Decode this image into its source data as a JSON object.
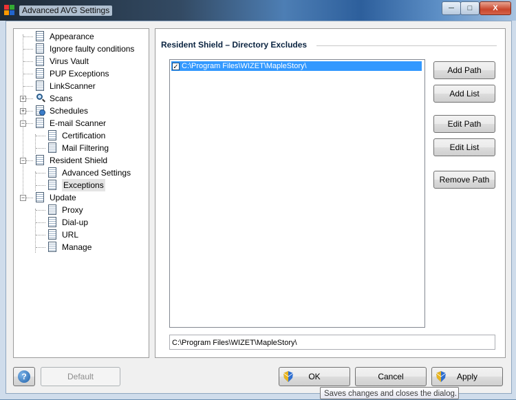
{
  "window": {
    "title": "Advanced AVG Settings",
    "minimize_label": "─",
    "maximize_label": "□",
    "close_label": "X"
  },
  "tree": {
    "items": [
      {
        "label": "Appearance",
        "level": 0,
        "icon": "page-icon"
      },
      {
        "label": "Ignore faulty conditions",
        "level": 0,
        "icon": "page-icon"
      },
      {
        "label": "Virus Vault",
        "level": 0,
        "icon": "page-icon"
      },
      {
        "label": "PUP Exceptions",
        "level": 0,
        "icon": "page-icon"
      },
      {
        "label": "LinkScanner",
        "level": 0,
        "icon": "page-icon"
      },
      {
        "label": "Scans",
        "level": 0,
        "icon": "magnifier-icon",
        "expander": "+"
      },
      {
        "label": "Schedules",
        "level": 0,
        "icon": "calendar-icon",
        "expander": "+"
      },
      {
        "label": "E-mail Scanner",
        "level": 0,
        "icon": "page-icon",
        "expander": "−"
      },
      {
        "label": "Certification",
        "level": 1,
        "icon": "page-icon"
      },
      {
        "label": "Mail Filtering",
        "level": 1,
        "icon": "page-icon"
      },
      {
        "label": "Resident Shield",
        "level": 0,
        "icon": "page-icon",
        "expander": "−"
      },
      {
        "label": "Advanced Settings",
        "level": 1,
        "icon": "page-icon"
      },
      {
        "label": "Exceptions",
        "level": 1,
        "icon": "page-icon",
        "selected": true
      },
      {
        "label": "Update",
        "level": 0,
        "icon": "page-icon",
        "expander": "−"
      },
      {
        "label": "Proxy",
        "level": 1,
        "icon": "page-icon"
      },
      {
        "label": "Dial-up",
        "level": 1,
        "icon": "page-icon"
      },
      {
        "label": "URL",
        "level": 1,
        "icon": "page-icon"
      },
      {
        "label": "Manage",
        "level": 1,
        "icon": "page-icon"
      }
    ]
  },
  "panel": {
    "heading": "Resident Shield – Directory Excludes",
    "list": [
      {
        "path": "C:\\Program Files\\WIZET\\MapleStory\\",
        "checked": true,
        "selected": true
      }
    ],
    "path_field_value": "C:\\Program Files\\WIZET\\MapleStory\\",
    "buttons": {
      "add_path": "Add Path",
      "add_list": "Add List",
      "edit_path": "Edit Path",
      "edit_list": "Edit List",
      "remove_path": "Remove Path"
    }
  },
  "footer": {
    "help_label": "?",
    "default_label": "Default",
    "ok_label": "OK",
    "cancel_label": "Cancel",
    "apply_label": "Apply"
  },
  "tooltip": "Saves changes and closes the dialog.",
  "colors": {
    "selection": "#3399ff",
    "dialog_bg": "#f0f0f0",
    "heading": "#0a2340"
  }
}
